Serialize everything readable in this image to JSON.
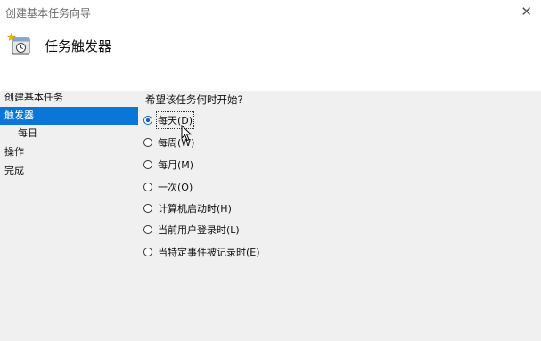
{
  "window": {
    "title": "创建基本任务向导",
    "close_label": "✕"
  },
  "header": {
    "title": "任务触发器",
    "icon": "task-scheduler-icon"
  },
  "sidebar": {
    "items": [
      {
        "label": "创建基本任务",
        "active": false,
        "sub": false
      },
      {
        "label": "触发器",
        "active": true,
        "sub": false
      },
      {
        "label": "每日",
        "active": false,
        "sub": true
      },
      {
        "label": "操作",
        "active": false,
        "sub": false
      },
      {
        "label": "完成",
        "active": false,
        "sub": false
      }
    ]
  },
  "main": {
    "question": "希望该任务何时开始?",
    "options": [
      {
        "label": "每天(D)",
        "checked": true
      },
      {
        "label": "每周(W)",
        "checked": false
      },
      {
        "label": "每月(M)",
        "checked": false
      },
      {
        "label": "一次(O)",
        "checked": false
      },
      {
        "label": "计算机启动时(H)",
        "checked": false
      },
      {
        "label": "当前用户登录时(L)",
        "checked": false
      },
      {
        "label": "当特定事件被记录时(E)",
        "checked": false
      }
    ]
  },
  "colors": {
    "accent": "#0a76d8",
    "panel_bg": "#f0f0f0"
  }
}
